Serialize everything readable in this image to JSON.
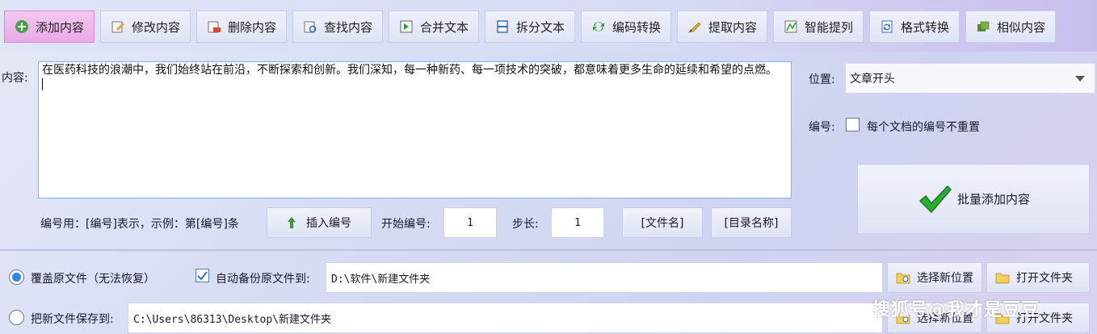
{
  "toolbar": {
    "items": [
      {
        "label": "添加内容",
        "icon": "add-icon",
        "active": true
      },
      {
        "label": "修改内容",
        "icon": "edit-icon",
        "active": false
      },
      {
        "label": "删除内容",
        "icon": "delete-icon",
        "active": false
      },
      {
        "label": "查找内容",
        "icon": "find-icon",
        "active": false
      },
      {
        "label": "合并文本",
        "icon": "merge-icon",
        "active": false
      },
      {
        "label": "拆分文本",
        "icon": "split-icon",
        "active": false
      },
      {
        "label": "编码转换",
        "icon": "encode-icon",
        "active": false
      },
      {
        "label": "提取内容",
        "icon": "extract-icon",
        "active": false
      },
      {
        "label": "智能提列",
        "icon": "column-icon",
        "active": false
      },
      {
        "label": "格式转换",
        "icon": "format-icon",
        "active": false
      },
      {
        "label": "相似内容",
        "icon": "similar-icon",
        "active": false
      }
    ]
  },
  "content": {
    "label": "内容:",
    "text": "在医药科技的浪潮中，我们始终站在前沿，不断探索和创新。我们深知，每一种新药、每一项技术的突破，都意味着更多生命的延续和希望的点燃。"
  },
  "position": {
    "label": "位置:",
    "selected": "文章开头"
  },
  "numbering": {
    "label": "编号:",
    "no_reset_label": "每个文档的编号不重置",
    "no_reset_checked": false,
    "hint": "编号用：[编号]表示，示例：第[编号]条",
    "insert_button": "插入编号",
    "start_label": "开始编号:",
    "start_value": "1",
    "step_label": "步长:",
    "step_value": "1",
    "filename_button": "[文件名]",
    "dirname_button": "[目录名称]"
  },
  "batch_button": "批量添加内容",
  "output": {
    "overwrite_label": "覆盖原文件（无法恢复）",
    "overwrite_selected": true,
    "backup_label": "自动备份原文件到:",
    "backup_checked": true,
    "backup_path": "D:\\软件\\新建文件夹",
    "choose_location": "选择新位置",
    "open_folder": "打开文件夹",
    "save_new_label": "把新文件保存到:",
    "save_new_selected": false,
    "save_new_path": "C:\\Users\\86313\\Desktop\\新建文件夹",
    "choose_location_2": "选择新位置",
    "open_folder_2": "打开文件夹"
  },
  "watermark": "搜狐号@我才是豆豆",
  "colors": {
    "accent": "#2f86e0",
    "active_tab": "#e9a9e6",
    "check_green": "#1f9a2a"
  }
}
